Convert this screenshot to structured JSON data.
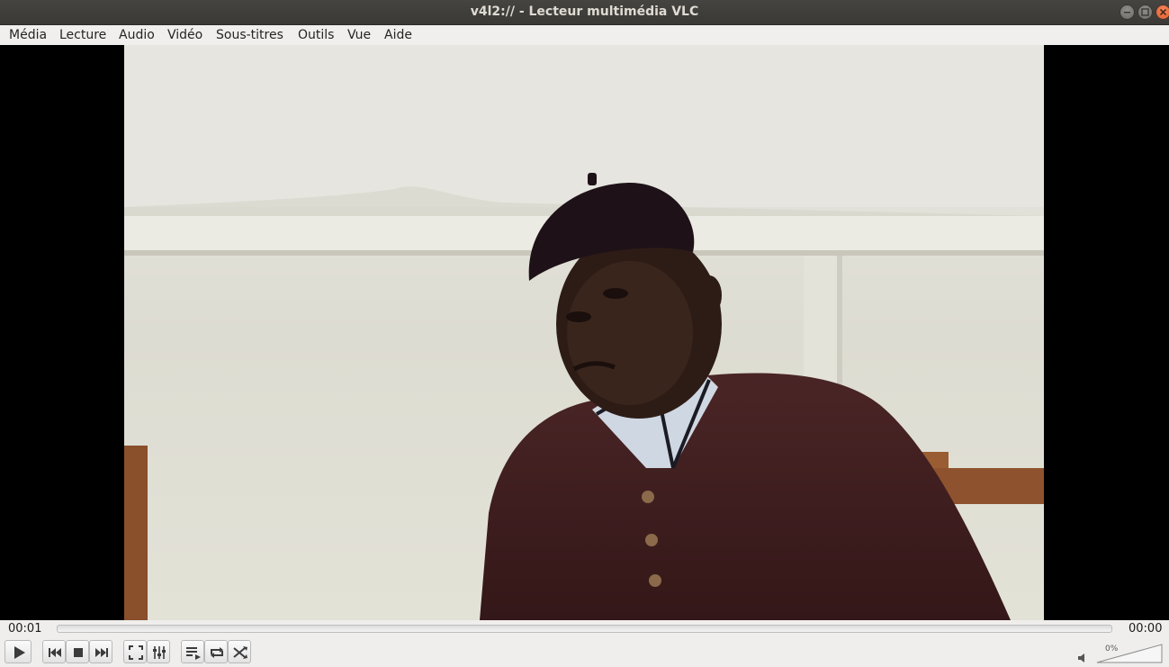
{
  "window": {
    "title": "v4l2:// - Lecteur multimédia VLC"
  },
  "menu": {
    "items": [
      {
        "label": "Média"
      },
      {
        "label": "Lecture"
      },
      {
        "label": "Audio"
      },
      {
        "label": "Vidéo"
      },
      {
        "label": "Sous-titres"
      },
      {
        "label": "Outils"
      },
      {
        "label": "Vue"
      },
      {
        "label": "Aide"
      }
    ]
  },
  "player": {
    "elapsed": "00:01",
    "remaining": "00:00",
    "seek_progress": 0.0,
    "volume_label": "0%",
    "volume_level": 0.0
  },
  "controls": {
    "icons": [
      "play-icon",
      "previous-icon",
      "stop-icon",
      "next-icon",
      "fullscreen-icon",
      "extended-settings-icon",
      "playlist-icon",
      "loop-icon",
      "shuffle-icon",
      "speaker-icon"
    ]
  }
}
